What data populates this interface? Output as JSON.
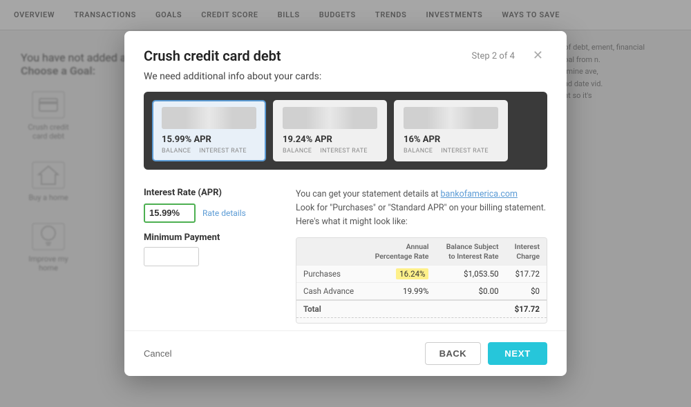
{
  "nav": {
    "items": [
      {
        "label": "OVERVIEW"
      },
      {
        "label": "TRANSACTIONS"
      },
      {
        "label": "GOALS"
      },
      {
        "label": "CREDIT SCORE"
      },
      {
        "label": "BILLS"
      },
      {
        "label": "BUDGETS"
      },
      {
        "label": "TRENDS"
      },
      {
        "label": "INVESTMENTS"
      },
      {
        "label": "WAYS TO SAVE"
      }
    ]
  },
  "bg": {
    "intro_text": "You have not added a",
    "choose_goal": "Choose a Goal:",
    "goals": [
      {
        "label": "Crush credit card debt"
      },
      {
        "label": "Buy a home"
      },
      {
        "label": "Improve my home"
      }
    ],
    "right_text": "t of debt, ement, financial",
    "right_text2": "goal from n.",
    "right_text3": "ermine ave,",
    "right_text4": "end date vid.",
    "right_text5": "unt so it's"
  },
  "modal": {
    "title": "Crush credit card debt",
    "step": "Step 2 of 4",
    "subtitle": "We need additional info about your cards:",
    "cards": [
      {
        "apr": "15.99% APR",
        "balance_label": "BALANCE",
        "rate_label": "INTEREST RATE",
        "selected": true
      },
      {
        "apr": "19.24% APR",
        "balance_label": "BALANCE",
        "rate_label": "INTEREST RATE",
        "selected": false
      },
      {
        "apr": "16% APR",
        "balance_label": "BALANCE",
        "rate_label": "INTEREST RATE",
        "selected": false
      }
    ],
    "interest_rate_section": {
      "title": "Interest Rate (APR)",
      "apr_value": "15.99%",
      "rate_details_label": "Rate details",
      "min_payment_title": "Minimum Payment"
    },
    "statement_text_1": "You can get your statement details at",
    "statement_link": "bankofamerica.com",
    "statement_text_2": "Look for \"Purchases\" or \"Standard APR\" on your billing statement.",
    "statement_text_3": "Here's what it might look like:",
    "table": {
      "headers": [
        "",
        "Annual\nPercentage Rate",
        "Balance Subject\nto Interest Rate",
        "Interest\nCharge"
      ],
      "rows": [
        {
          "label": "Purchases",
          "apr": "16.24%",
          "balance": "$1,053.50",
          "interest": "$17.72",
          "highlight_apr": true
        },
        {
          "label": "Cash Advance",
          "apr": "19.99%",
          "balance": "$0.00",
          "interest": "$0",
          "highlight_apr": false
        },
        {
          "label": "Total",
          "apr": "",
          "balance": "",
          "interest": "$17.72",
          "is_total": true
        }
      ]
    },
    "footer": {
      "cancel_label": "Cancel",
      "back_label": "BACK",
      "next_label": "NEXT"
    }
  }
}
